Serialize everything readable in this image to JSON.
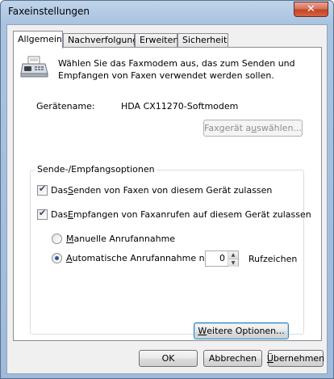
{
  "window": {
    "title": "Faxeinstellungen",
    "close_label": "✕"
  },
  "tabs": [
    {
      "label": "Allgemein",
      "active": true
    },
    {
      "label": "Nachverfolgung",
      "active": false
    },
    {
      "label": "Erweitert",
      "active": false
    },
    {
      "label": "Sicherheit",
      "active": false
    }
  ],
  "general": {
    "intro_text": "Wählen Sie das Faxmodem aus, das zum Senden und Empfangen von Faxen verwendet werden sollen.",
    "device_label": "Gerätename:",
    "device_value": "HDA CX11270-Softmodem",
    "select_device_button": {
      "pre": "Faxgerät a",
      "key": "u",
      "post": "swählen..."
    }
  },
  "options": {
    "group_title": "Sende-/Empfangsoptionen",
    "allow_send": {
      "pre": "Das ",
      "key": "S",
      "post": "enden von Faxen von diesem Gerät zulassen",
      "checked": true
    },
    "allow_receive": {
      "pre": "Das ",
      "key": "E",
      "post": "mpfangen von Faxanrufen auf diesem Gerät zulassen",
      "checked": true
    },
    "manual_answer": {
      "pre": "",
      "key": "M",
      "post": "anuelle Anrufannahme",
      "selected": false
    },
    "auto_answer": {
      "pre": "",
      "key": "A",
      "post": "utomatische Anrufannahme nach",
      "selected": true
    },
    "rings_value": "0",
    "rings_label": "Rufzeichen",
    "more_options_button": {
      "pre": "",
      "key": "W",
      "post": "eitere Optionen..."
    }
  },
  "footer": {
    "ok_label": "OK",
    "cancel_label": "Abbrechen",
    "apply_button": {
      "pre": "",
      "key": "Ü",
      "post": "bernehmen"
    }
  },
  "colors": {
    "frame": "#a9c3e0",
    "close_button": "#c44425",
    "client_bg": "#f0f0f0",
    "panel_bg": "#ffffff"
  },
  "icons": {
    "close": "close-icon",
    "fax": "fax-machine-icon"
  }
}
